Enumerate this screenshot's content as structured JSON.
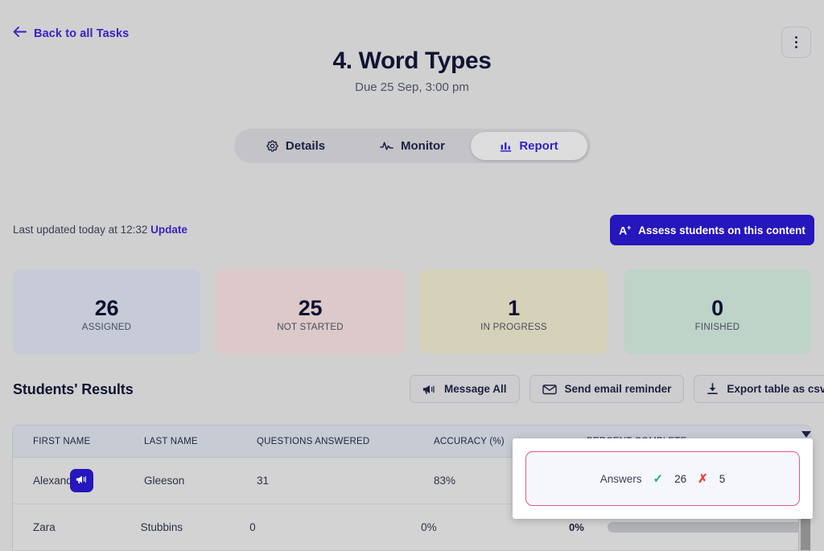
{
  "topbar": {
    "back_label": "Back to all Tasks",
    "back_icon": "arrow-left-icon",
    "kebab_icon": "more-vertical-icon"
  },
  "header": {
    "title": "4. Word Types",
    "subtitle": "Due 25 Sep, 3:00 pm"
  },
  "tabs": [
    {
      "label": "Details",
      "icon": "gear-icon",
      "active": false
    },
    {
      "label": "Monitor",
      "icon": "activity-pulse-icon",
      "active": false
    },
    {
      "label": "Report",
      "icon": "bar-chart-icon",
      "active": true
    }
  ],
  "meta": {
    "updated_text": "Last updated today at 12:32",
    "update_link": "Update",
    "assess_button": "Assess students on this content",
    "assess_icon": "a-plus-icon"
  },
  "stats": [
    {
      "value": "26",
      "label": "ASSIGNED",
      "color": "#c6cbd7"
    },
    {
      "value": "25",
      "label": "NOT STARTED",
      "color": "#ddc9c9"
    },
    {
      "value": "1",
      "label": "IN PROGRESS",
      "color": "#d6d1b9"
    },
    {
      "value": "0",
      "label": "FINISHED",
      "color": "#bed4c8"
    }
  ],
  "results": {
    "title": "Students' Results",
    "actions": [
      {
        "label": "Message All",
        "icon": "megaphone-icon"
      },
      {
        "label": "Send email reminder",
        "icon": "envelope-icon"
      },
      {
        "label": "Export table as csv",
        "icon": "download-icon"
      }
    ],
    "columns": [
      "FIRST NAME",
      "LAST NAME",
      "QUESTIONS ANSWERED",
      "ACCURACY (%)",
      "PERCENT COMPLETE"
    ],
    "rows": [
      {
        "first_name": "Alexand...",
        "last_name": "Gleeson",
        "questions_answered": "31",
        "accuracy": "83%",
        "percent_complete": "",
        "percent_value": 0,
        "badge_icon": "megaphone-icon"
      },
      {
        "first_name": "Zara",
        "last_name": "Stubbins",
        "questions_answered": "0",
        "accuracy": "0%",
        "percent_complete": "0%",
        "percent_value": 0,
        "badge_icon": ""
      }
    ]
  },
  "popup": {
    "label": "Answers",
    "correct_icon": "check-icon",
    "correct_value": "26",
    "incorrect_icon": "cross-icon",
    "incorrect_value": "5",
    "border_color": "#e2588c"
  }
}
